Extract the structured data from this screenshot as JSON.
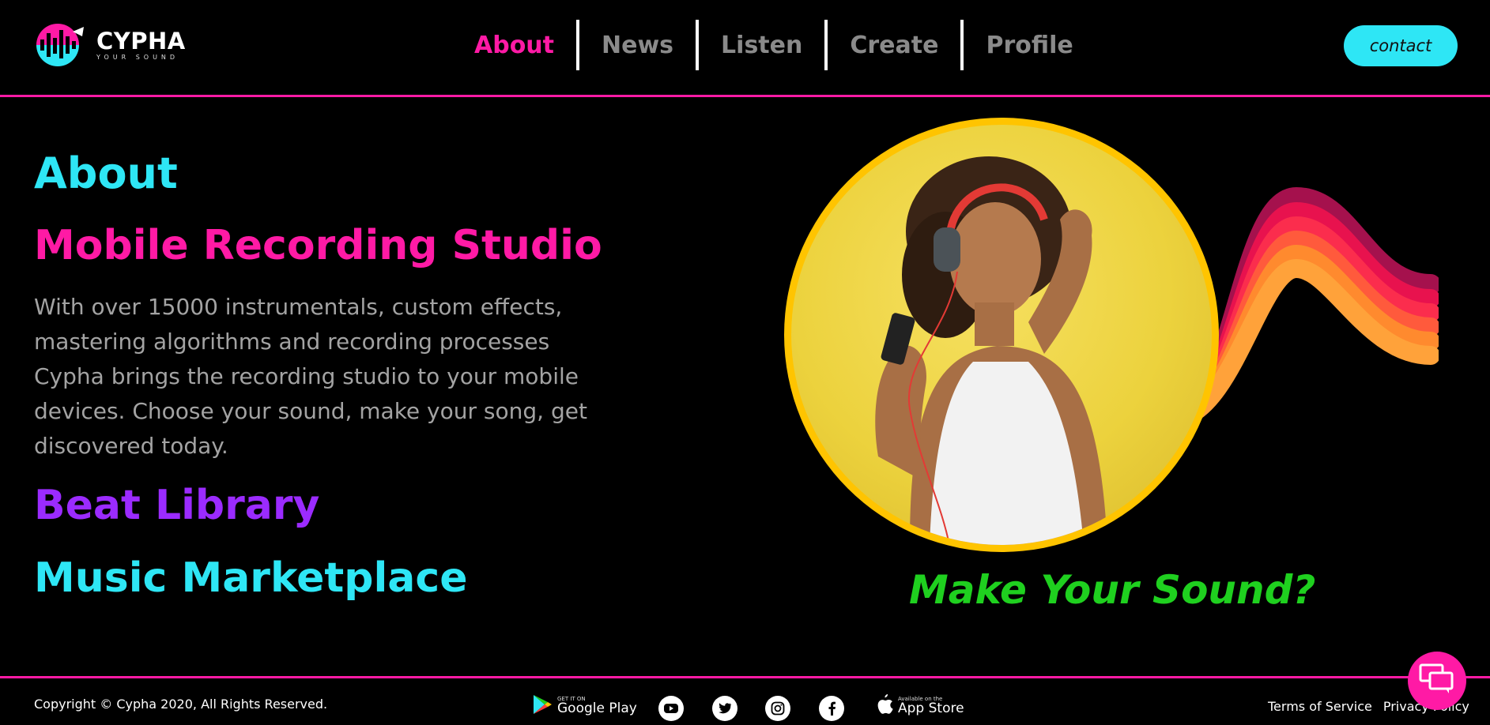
{
  "brand": {
    "name": "CYPHA",
    "tagline": "YOUR SOUND",
    "colors": {
      "pink": "#ff1aa5",
      "cyan": "#2ee6f5",
      "purple": "#9b2bff",
      "green": "#1fd01f",
      "gold": "#ffc400"
    }
  },
  "nav": {
    "items": [
      {
        "label": "About",
        "active": true
      },
      {
        "label": "News",
        "active": false
      },
      {
        "label": "Listen",
        "active": false
      },
      {
        "label": "Create",
        "active": false
      },
      {
        "label": "Profile",
        "active": false
      }
    ],
    "contact_label": "contact"
  },
  "main": {
    "heading": "About",
    "section1_title": "Mobile Recording Studio",
    "section1_text": "With over 15000 instrumentals, custom effects, mastering algorithms and recording processes Cypha brings the recording studio to your mobile devices. Choose your sound, make your song, get discovered today.",
    "section2_title": "Beat Library",
    "section3_title": "Music Marketplace",
    "hero_tagline": "Make Your Sound?"
  },
  "footer": {
    "copyright": "Copyright © Cypha 2020, All Rights Reserved.",
    "google_play": {
      "small": "GET IT ON",
      "big": "Google Play"
    },
    "app_store": {
      "small": "Available on the",
      "big": "App Store"
    },
    "social_icons": [
      "youtube-icon",
      "twitter-icon",
      "instagram-icon",
      "facebook-icon"
    ],
    "terms_label": "Terms of Service",
    "privacy_label": "Privacy Policy"
  }
}
